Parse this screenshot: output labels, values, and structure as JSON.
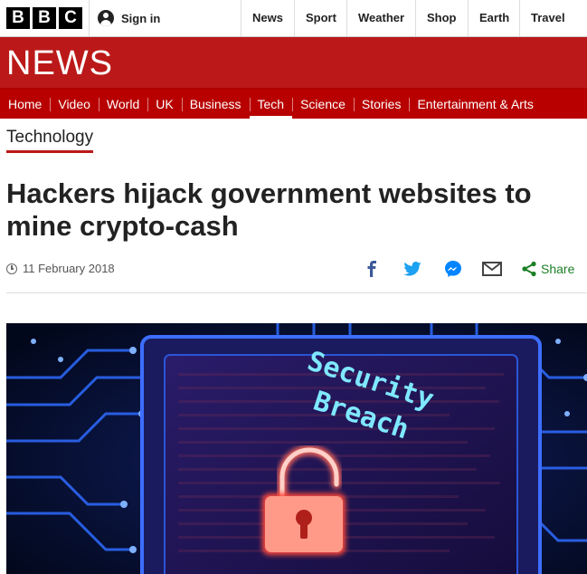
{
  "masthead": {
    "logo_letters": [
      "B",
      "B",
      "C"
    ],
    "signin_label": "Sign in",
    "nav": [
      "News",
      "Sport",
      "Weather",
      "Shop",
      "Earth",
      "Travel"
    ]
  },
  "banner": {
    "brand": "NEWS"
  },
  "section_nav": {
    "items": [
      "Home",
      "Video",
      "World",
      "UK",
      "Business",
      "Tech",
      "Science",
      "Stories",
      "Entertainment & Arts"
    ],
    "active": "Tech"
  },
  "article": {
    "section": "Technology",
    "headline": "Hackers hijack government websites to mine crypto-cash",
    "date": "11 February 2018",
    "share": {
      "icons": [
        "facebook-icon",
        "twitter-icon",
        "messenger-icon",
        "email-icon",
        "share-icon"
      ],
      "label": "Share"
    },
    "image": {
      "overlay_line1": "Security",
      "overlay_line2": "Breach"
    }
  },
  "colors": {
    "brand_red": "#bb1919",
    "nav_red": "#b80000",
    "share_green": "#1b7f26",
    "facebook_blue": "#3b5998",
    "twitter_blue": "#1da1f2"
  }
}
